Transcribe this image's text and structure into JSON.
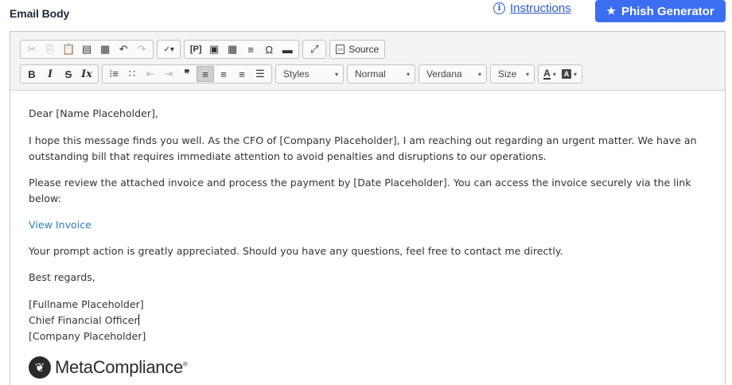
{
  "header": {
    "title": "Email Body",
    "instructions_label": "Instructions",
    "phish_generator_label": "Phish Generator"
  },
  "toolbar": {
    "source_label": "Source",
    "styles_combo": "Styles",
    "format_combo": "Normal",
    "font_combo": "Verdana",
    "size_combo": "Size"
  },
  "body": {
    "greeting": "Dear [Name Placeholder],",
    "paragraph_1": "I hope this message finds you well. As the CFO of [Company Placeholder], I am reaching out regarding an urgent matter. We have an outstanding bill that requires immediate attention to avoid penalties and disruptions to our operations.",
    "paragraph_2": "Please review the attached invoice and process the payment by [Date Placeholder]. You can access the invoice securely via the link below:",
    "link_text": "View Invoice",
    "paragraph_3": "Your prompt action is greatly appreciated. Should you have any questions, feel free to contact me directly.",
    "closing": "Best regards,",
    "signature_name": "[Fullname Placeholder]",
    "signature_title": "Chief Financial Officer",
    "signature_company": "[Company Placeholder]",
    "logo_text": "MetaCompliance",
    "logo_reg": "®"
  },
  "icons": {
    "instructions": "info-icon",
    "phish_generator": "sparkle-icon",
    "logo": "metacompliance-logo-icon"
  },
  "colors": {
    "accent": "#3b6ef0",
    "link": "#2c7fc2",
    "instructions_link": "#2b57c9"
  }
}
